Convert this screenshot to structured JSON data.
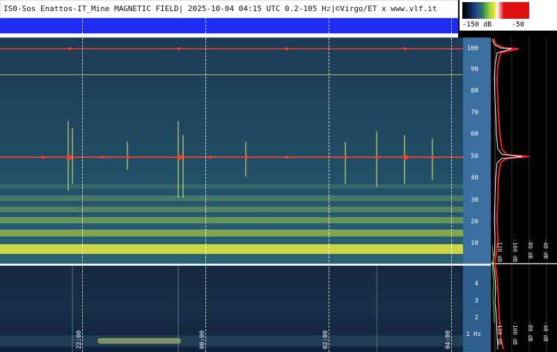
{
  "header": {
    "title": "IS0-Sos Enattos-IT_Mine MAGNETIC FIELD| 2025-10-04 04:15 UTC 0.2-105 Hz|©Virgo/ET x www.vlf.it"
  },
  "colorbar": {
    "min_label": "-150 dB",
    "max_label": "-50",
    "colors": [
      "#000000",
      "#25408d",
      "#2a7d60",
      "#e9e320",
      "#ffffff",
      "#e01010"
    ]
  },
  "time_axis": {
    "labels": [
      "22:00",
      "00:00",
      "02:00",
      "04:00"
    ]
  },
  "frequency_axis_top": {
    "unit": "Hz",
    "ticks": [
      "100",
      "90",
      "80",
      "70",
      "60",
      "50",
      "40",
      "30",
      "20",
      "10"
    ]
  },
  "frequency_axis_bottom": {
    "ticks": [
      "4",
      "3",
      "2",
      "1 Hz"
    ]
  },
  "spectrum_profile": {
    "db_labels_top": [
      "-120 dB",
      "-100 dB",
      "-80 dB",
      "-40 dB"
    ],
    "db_labels_bottom": [
      "-120 dB",
      "-100 dB",
      "-80 dB",
      "-40 dB"
    ],
    "line_colors": {
      "max": "#ff2020",
      "mean": "#ffffff",
      "min": "#40e040"
    }
  },
  "spectrogram": {
    "strong_lines_hz": [
      100,
      50
    ],
    "accent_line_color": "#ff3a2a",
    "reference_line_color": "#c8c85a"
  }
}
